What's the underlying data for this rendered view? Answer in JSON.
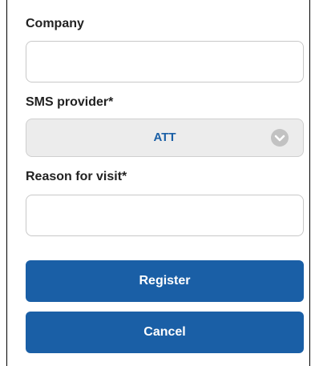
{
  "form": {
    "company": {
      "label": "Company",
      "value": "",
      "placeholder": ""
    },
    "sms_provider": {
      "label": "SMS provider*",
      "selected": "ATT",
      "icon": "chevron-down-icon"
    },
    "reason": {
      "label": "Reason for visit*",
      "value": "",
      "placeholder": ""
    }
  },
  "buttons": {
    "register": "Register",
    "cancel": "Cancel"
  },
  "colors": {
    "primary": "#1a5fa6",
    "select_bg": "#ececec",
    "chevron": "#c2c2c2"
  }
}
